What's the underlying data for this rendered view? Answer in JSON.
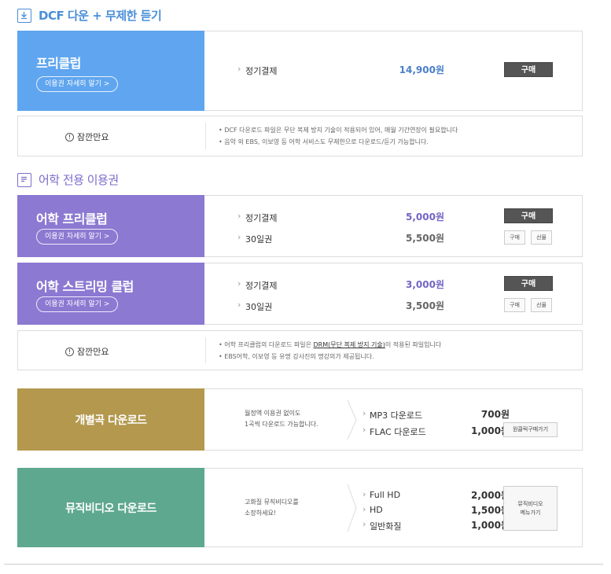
{
  "section1": {
    "title": "DCF 다운 + 무제한 듣기"
  },
  "free_club": {
    "name": "프리클럽",
    "detail": "이용권 자세히 알기 >",
    "rows": [
      {
        "label": "정기결제",
        "price": "14,900원",
        "button": "구매"
      }
    ],
    "color": "#5fa5ef"
  },
  "notice1": {
    "title": "잠깐만요",
    "lines": [
      "• DCF 다운로드 파일은 무단 복제 방지 기술이 적용되어 있어, 매월 기간연장이 필요합니다",
      "• 음악 외 EBS, 이보영 등 어학 서비스도 무제한으로 다운로드/듣기 가능합니다."
    ]
  },
  "section2": {
    "title": "어학 전용 이용권"
  },
  "lang_free_club": {
    "name": "어학 프리클럽",
    "detail": "이용권 자세히 알기 >",
    "rows": [
      {
        "label": "정기결제",
        "price": "5,000원",
        "button": "구매"
      },
      {
        "label": "30일권",
        "price": "5,500원",
        "button_buy": "구매",
        "button_gift": "선물"
      }
    ],
    "color": "#8b79d2"
  },
  "lang_streaming_club": {
    "name": "어학 스트리밍 클럽",
    "detail": "이용권 자세히 알기 >",
    "rows": [
      {
        "label": "정기결제",
        "price": "3,000원",
        "button": "구매"
      },
      {
        "label": "30일권",
        "price": "3,500원",
        "button_buy": "구매",
        "button_gift": "선물"
      }
    ],
    "color": "#8b79d2"
  },
  "notice2": {
    "title": "잠깐만요",
    "line1_pre": "• 어학 프리클럽의 다운로드 파일은 ",
    "line1_link": "DRM(무단 복제 방지 기술)",
    "line1_post": "이 적용된 파일입니다",
    "line2": "• EBS어학, 이보영 등 유명 강사진의 명강의가 제공됩니다."
  },
  "single_download": {
    "name": "개별곡 다운로드",
    "desc": [
      "월정액 이용권 없이도",
      "1곡씩 다운로드 가능합니다."
    ],
    "rows": [
      {
        "label": "MP3 다운로드",
        "price": "700원"
      },
      {
        "label": "FLAC 다운로드",
        "price": "1,000원"
      }
    ],
    "button": "원클릭구매가기",
    "color": "#b3984e"
  },
  "mv_download": {
    "name": "뮤직비디오 다운로드",
    "desc": [
      "고화질 뮤직비디오를",
      "소장하세요!"
    ],
    "rows": [
      {
        "label": "Full HD",
        "price": "2,000원"
      },
      {
        "label": "HD",
        "price": "1,500원"
      },
      {
        "label": "일반화질",
        "price": "1,000원"
      }
    ],
    "button_line1": "뮤직비디오",
    "button_line2": "메뉴가기",
    "color": "#5ea88f"
  },
  "colors": {
    "blue_title": "#4a8fd8",
    "purple_title": "#7d6ccc",
    "price_blue": "#4a7fc9",
    "price_purple": "#7265c4"
  }
}
